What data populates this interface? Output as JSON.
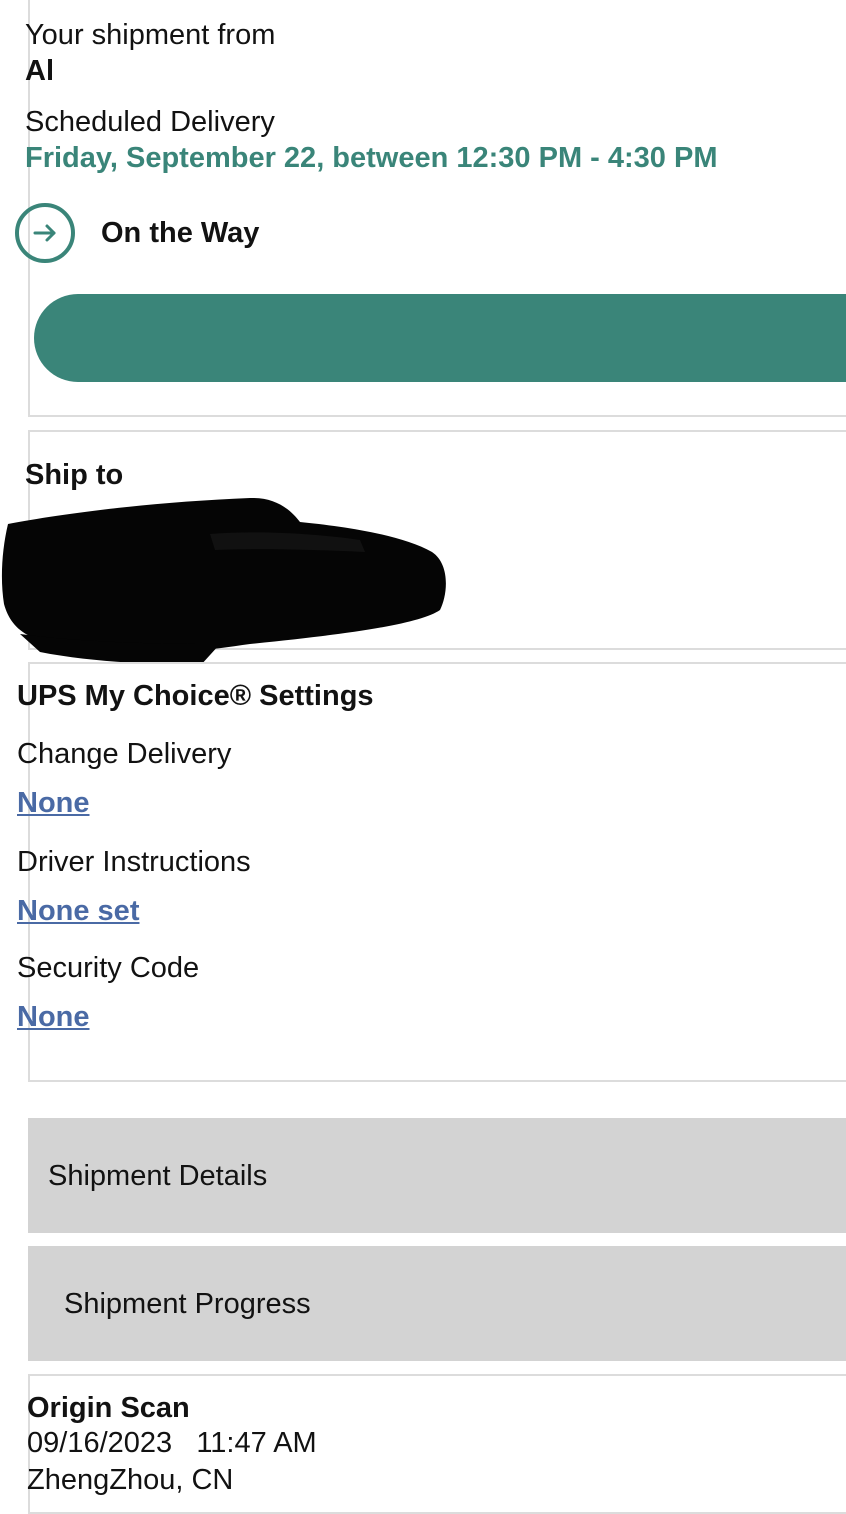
{
  "status": {
    "from_label": "Your shipment from",
    "from_name": "Al",
    "scheduled_label": "Scheduled Delivery",
    "scheduled_value": "Friday, September 22, between 12:30 PM - 4:30 PM",
    "status_text": "On the Way",
    "status_icon": "arrow-right-circle-icon",
    "accent_color": "#3a8579"
  },
  "ship_to": {
    "label": "Ship to"
  },
  "my_choice": {
    "title": "UPS My Choice® Settings",
    "change_delivery_label": "Change Delivery",
    "change_delivery_value": "None",
    "driver_instructions_label": "Driver Instructions",
    "driver_instructions_value": "None set",
    "security_code_label": "Security Code",
    "security_code_value": "None",
    "link_color": "#4a6aa5"
  },
  "sections": {
    "details_label": "Shipment Details",
    "progress_label": "Shipment Progress"
  },
  "scan": {
    "title": "Origin Scan",
    "datetime": "09/16/2023   11:47 AM",
    "location": "ZhengZhou, CN"
  }
}
